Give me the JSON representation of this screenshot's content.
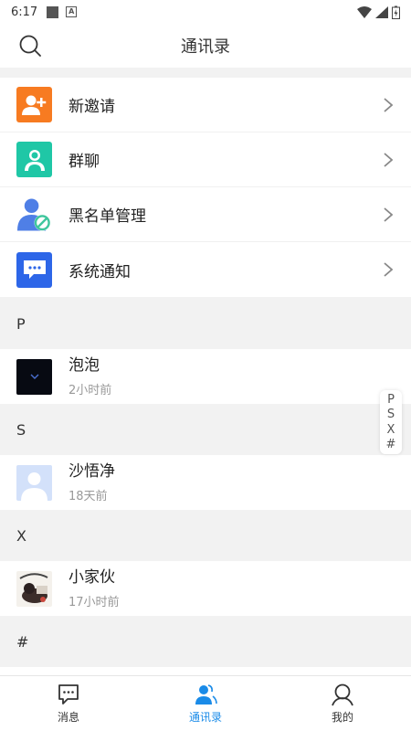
{
  "status": {
    "time": "6:17"
  },
  "header": {
    "title": "通讯录"
  },
  "menu": [
    {
      "label": "新邀请",
      "icon": "add-user-icon",
      "color": "#f77b21"
    },
    {
      "label": "群聊",
      "icon": "group-chat-icon",
      "color": "#1fc7a6"
    },
    {
      "label": "黑名单管理",
      "icon": "blacklist-icon",
      "color": "#4f7fe6"
    },
    {
      "label": "系统通知",
      "icon": "system-notice-icon",
      "color": "#2d66e8"
    }
  ],
  "sections": [
    {
      "letter": "P",
      "contacts": [
        {
          "name": "泡泡",
          "time": "2小时前"
        }
      ]
    },
    {
      "letter": "S",
      "contacts": [
        {
          "name": "沙悟净",
          "time": "18天前"
        }
      ]
    },
    {
      "letter": "X",
      "contacts": [
        {
          "name": "小家伙",
          "time": "17小时前"
        }
      ]
    },
    {
      "letter": "#",
      "contacts": []
    }
  ],
  "index": [
    "P",
    "S",
    "X",
    "#"
  ],
  "tabs": [
    {
      "label": "消息",
      "icon": "message-icon",
      "active": false
    },
    {
      "label": "通讯录",
      "icon": "contacts-icon",
      "active": true
    },
    {
      "label": "我的",
      "icon": "profile-icon",
      "active": false
    }
  ],
  "colors": {
    "accent": "#1a8be8"
  }
}
